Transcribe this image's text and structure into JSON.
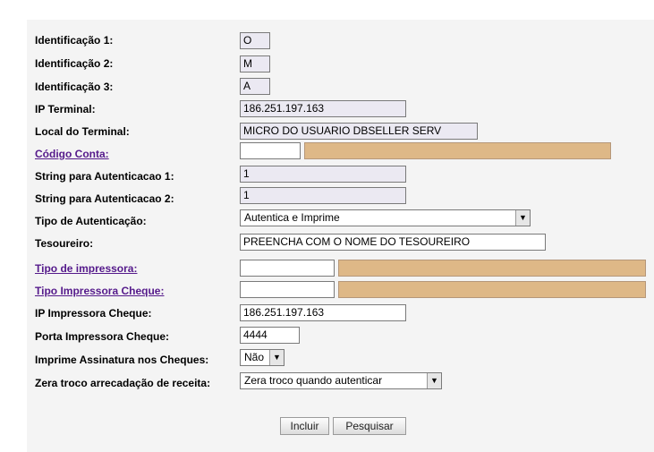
{
  "form": {
    "fields": {
      "id1": {
        "label": "Identificação 1:",
        "value": "O"
      },
      "id2": {
        "label": "Identificação 2:",
        "value": "M"
      },
      "id3": {
        "label": "Identificação 3:",
        "value": "A"
      },
      "ip_terminal": {
        "label": "IP Terminal:",
        "value": "186.251.197.163"
      },
      "local_terminal": {
        "label": "Local do Terminal:",
        "value": "MICRO DO USUARIO DBSELLER SERV"
      },
      "codigo_conta": {
        "label": "Código Conta:",
        "value": "",
        "desc": ""
      },
      "string_aut1": {
        "label": "String para Autenticacao 1:",
        "value": "1"
      },
      "string_aut2": {
        "label": "String para Autenticacao 2:",
        "value": "1"
      },
      "tipo_autenticacao": {
        "label": "Tipo de Autenticação:",
        "value": "Autentica e Imprime"
      },
      "tesoureiro": {
        "label": "Tesoureiro:",
        "value": "PREENCHA COM O NOME DO TESOUREIRO"
      },
      "tipo_impressora": {
        "label": "Tipo de impressora:",
        "value": "",
        "desc": ""
      },
      "tipo_impressora_cheque": {
        "label": "Tipo Impressora Cheque:",
        "value": "",
        "desc": ""
      },
      "ip_impressora_cheque": {
        "label": "IP Impressora Cheque:",
        "value": "186.251.197.163"
      },
      "porta_impressora_cheque": {
        "label": "Porta Impressora Cheque:",
        "value": "4444"
      },
      "imprime_assinatura": {
        "label": "Imprime Assinatura nos Cheques:",
        "value": "Não"
      },
      "zera_troco": {
        "label": "Zera troco arrecadação de receita:",
        "value": "Zera troco quando autenticar"
      }
    },
    "buttons": {
      "incluir": "Incluir",
      "pesquisar": "Pesquisar"
    },
    "colors": {
      "readonly_bg": "#ebe9f2",
      "lookup_bg": "#deb887",
      "link": "#551a8b",
      "panel_bg": "#f4f4f4"
    },
    "icons": {
      "dropdown": "chevron-down-icon"
    }
  }
}
